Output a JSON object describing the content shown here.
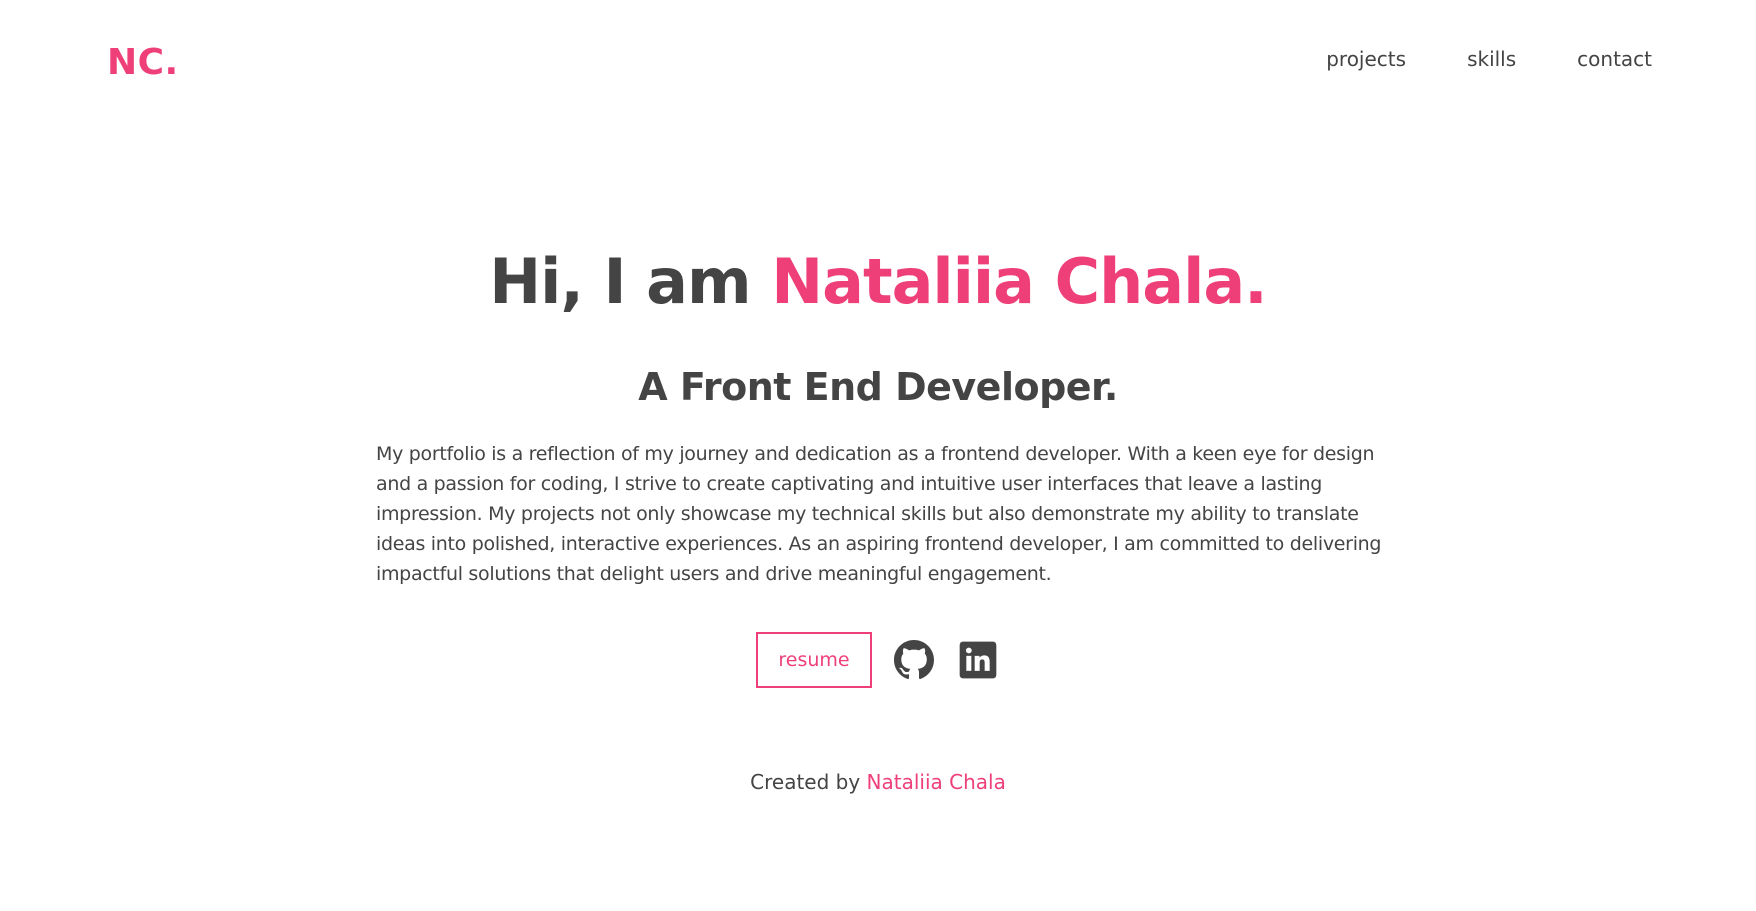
{
  "colors": {
    "accent": "#ee3f79",
    "text": "#444444",
    "background": "#ffffff"
  },
  "header": {
    "logo": "NC.",
    "nav": [
      {
        "label": "projects"
      },
      {
        "label": "skills"
      },
      {
        "label": "contact"
      }
    ]
  },
  "hero": {
    "greeting": "Hi, I am",
    "name": "Nataliia Chala.",
    "role": "A Front End Developer.",
    "bio": "My portfolio is a reflection of my journey and dedication as a frontend developer. With a keen eye for design and a passion for coding, I strive to create captivating and intuitive user interfaces that leave a lasting impression. My projects not only showcase my technical skills but also demonstrate my ability to translate ideas into polished, interactive experiences. As an aspiring frontend developer, I am committed to delivering impactful solutions that delight users and drive meaningful engagement."
  },
  "actions": {
    "resume_label": "resume",
    "icons": [
      "github-icon",
      "linkedin-icon"
    ]
  },
  "footer": {
    "prefix": "Created by",
    "author": "Nataliia Chala"
  }
}
